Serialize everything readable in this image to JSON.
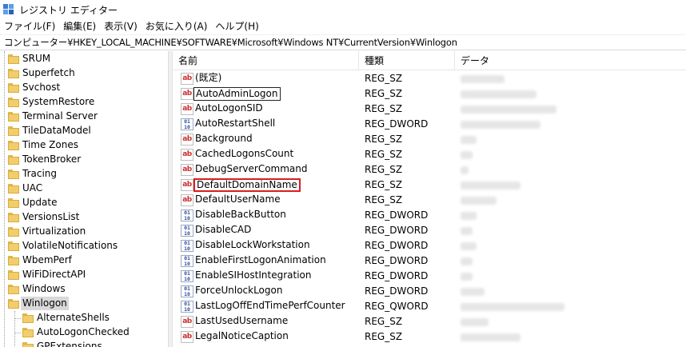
{
  "window": {
    "title": "レジストリ エディター"
  },
  "menu": [
    {
      "label": "ファイル(F)"
    },
    {
      "label": "編集(E)"
    },
    {
      "label": "表示(V)"
    },
    {
      "label": "お気に入り(A)"
    },
    {
      "label": "ヘルプ(H)"
    }
  ],
  "address": {
    "path": "コンピューター¥HKEY_LOCAL_MACHINE¥SOFTWARE¥Microsoft¥Windows NT¥CurrentVersion¥Winlogon"
  },
  "tree": {
    "items": [
      {
        "label": "SRUM"
      },
      {
        "label": "Superfetch"
      },
      {
        "label": "Svchost"
      },
      {
        "label": "SystemRestore"
      },
      {
        "label": "Terminal Server"
      },
      {
        "label": "TileDataModel"
      },
      {
        "label": "Time Zones"
      },
      {
        "label": "TokenBroker"
      },
      {
        "label": "Tracing"
      },
      {
        "label": "UAC"
      },
      {
        "label": "Update"
      },
      {
        "label": "VersionsList"
      },
      {
        "label": "Virtualization"
      },
      {
        "label": "VolatileNotifications"
      },
      {
        "label": "WbemPerf"
      },
      {
        "label": "WiFiDirectAPI"
      },
      {
        "label": "Windows"
      },
      {
        "label": "Winlogon",
        "selected": true
      },
      {
        "label": "AlternateShells",
        "child": true
      },
      {
        "label": "AutoLogonChecked",
        "child": true
      },
      {
        "label": "GPExtensions",
        "child": true
      }
    ]
  },
  "list": {
    "headers": {
      "name": "名前",
      "type": "種類",
      "data": "データ"
    },
    "rows": [
      {
        "name": "(既定)",
        "type": "REG_SZ",
        "icon": "string-value-icon"
      },
      {
        "name": "AutoAdminLogon",
        "type": "REG_SZ",
        "icon": "string-value-icon",
        "focused": true
      },
      {
        "name": "AutoLogonSID",
        "type": "REG_SZ",
        "icon": "string-value-icon"
      },
      {
        "name": "AutoRestartShell",
        "type": "REG_DWORD",
        "icon": "binary-value-icon"
      },
      {
        "name": "Background",
        "type": "REG_SZ",
        "icon": "string-value-icon"
      },
      {
        "name": "CachedLogonsCount",
        "type": "REG_SZ",
        "icon": "string-value-icon"
      },
      {
        "name": "DebugServerCommand",
        "type": "REG_SZ",
        "icon": "string-value-icon"
      },
      {
        "name": "DefaultDomainName",
        "type": "REG_SZ",
        "icon": "string-value-icon",
        "highlighted": true
      },
      {
        "name": "DefaultUserName",
        "type": "REG_SZ",
        "icon": "string-value-icon"
      },
      {
        "name": "DisableBackButton",
        "type": "REG_DWORD",
        "icon": "binary-value-icon"
      },
      {
        "name": "DisableCAD",
        "type": "REG_DWORD",
        "icon": "binary-value-icon"
      },
      {
        "name": "DisableLockWorkstation",
        "type": "REG_DWORD",
        "icon": "binary-value-icon"
      },
      {
        "name": "EnableFirstLogonAnimation",
        "type": "REG_DWORD",
        "icon": "binary-value-icon"
      },
      {
        "name": "EnableSIHostIntegration",
        "type": "REG_DWORD",
        "icon": "binary-value-icon"
      },
      {
        "name": "ForceUnlockLogon",
        "type": "REG_DWORD",
        "icon": "binary-value-icon"
      },
      {
        "name": "LastLogOffEndTimePerfCounter",
        "type": "REG_QWORD",
        "icon": "binary-value-icon"
      },
      {
        "name": "LastUsedUsername",
        "type": "REG_SZ",
        "icon": "string-value-icon"
      },
      {
        "name": "LegalNoticeCaption",
        "type": "REG_SZ",
        "icon": "string-value-icon"
      }
    ]
  },
  "colors": {
    "highlight_border": "#d91e1e",
    "selection_bg": "#d9d9d9",
    "folder": "#f2cd6e"
  }
}
